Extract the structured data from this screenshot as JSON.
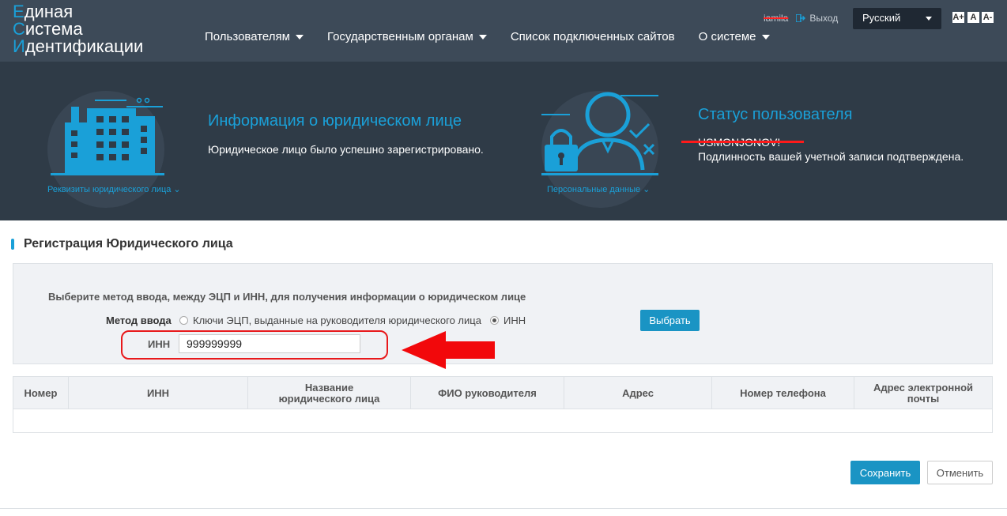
{
  "header": {
    "logo_lines": [
      "Единая",
      "Система",
      "Идентификации"
    ],
    "logo_caps": [
      "Е",
      "С",
      "И"
    ],
    "logo_rest": [
      "диная",
      "истема",
      "дентификации"
    ],
    "nav": [
      {
        "label": "Пользователям",
        "dropdown": true
      },
      {
        "label": "Государственным органам",
        "dropdown": true
      },
      {
        "label": "Список подключенных сайтов",
        "dropdown": false
      },
      {
        "label": "О системе",
        "dropdown": true
      }
    ],
    "username": "iamila",
    "logout_label": "Выход",
    "language": "Русский",
    "font_controls": [
      "A+",
      "A",
      "A-"
    ]
  },
  "hero": {
    "org_caption": "Реквизиты юридического лица",
    "org_title": "Информация о юридическом лице",
    "org_text": "Юридическое лицо было успешно зарегистрировано.",
    "user_caption": "Персональные данные",
    "user_title": "Статус пользователя",
    "user_name": "USMONJONOV!",
    "user_text": "Подлинность вашей учетной записи подтверждена."
  },
  "section": {
    "title": "Регистрация Юридического лица"
  },
  "form": {
    "hint": "Выберите метод ввода, между ЭЦП и ИНН, для получения информации о юридическом лице",
    "method_label": "Метод ввода",
    "option_eds": "Ключи ЭЦП, выданные на руководителя юридического лица",
    "option_inn": "ИНН",
    "selected_option": "ИНН",
    "select_button": "Выбрать",
    "inn_label": "ИНН",
    "inn_value": "999999999"
  },
  "table": {
    "columns": [
      "Номер",
      "ИНН",
      "Название юридического лица",
      "ФИО руководителя",
      "Адрес",
      "Номер телефона",
      "Адрес электронной почты"
    ],
    "rows": []
  },
  "actions": {
    "save": "Сохранить",
    "cancel": "Отменить"
  },
  "colors": {
    "topbar": "#3d4a58",
    "hero": "#2f3b47",
    "accent": "#1aa0d8",
    "primary_button": "#1a94c4",
    "annotation_red": "#e8191b"
  }
}
